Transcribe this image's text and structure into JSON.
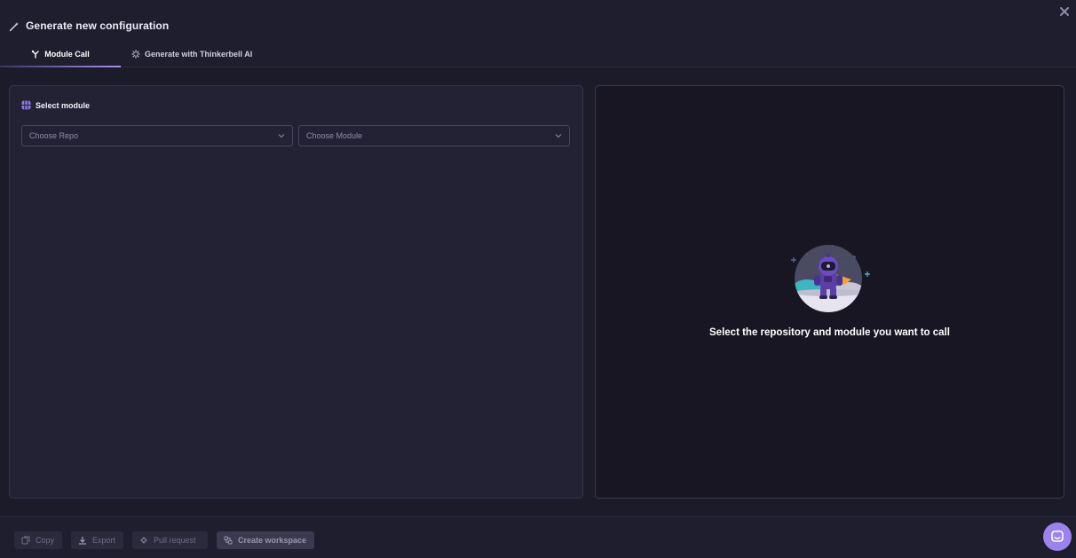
{
  "header": {
    "title": "Generate new configuration",
    "title_icon": "magic-wand-icon",
    "close_icon": "close-icon"
  },
  "tabs": [
    {
      "label": "Module Call",
      "icon": "module-call-icon",
      "active": true
    },
    {
      "label": "Generate with Thinkerbell AI",
      "icon": "sparkle-icon",
      "active": false
    }
  ],
  "left_panel": {
    "section_title": "Select module",
    "section_icon": "module-grid-icon",
    "repo_select": {
      "placeholder": "Choose Repo"
    },
    "module_select": {
      "placeholder": "Choose Module"
    }
  },
  "right_panel": {
    "illustration": "astronaut-illustration",
    "message": "Select the repository and module you want to call"
  },
  "footer": {
    "copy_label": "Copy",
    "export_label": "Export",
    "pull_request_label": "Pull request",
    "create_workspace_label": "Create workspace"
  },
  "colors": {
    "accent": "#9a83ec",
    "background": "#1c1b29",
    "panel": "#232235",
    "panel_dark": "#171622"
  }
}
